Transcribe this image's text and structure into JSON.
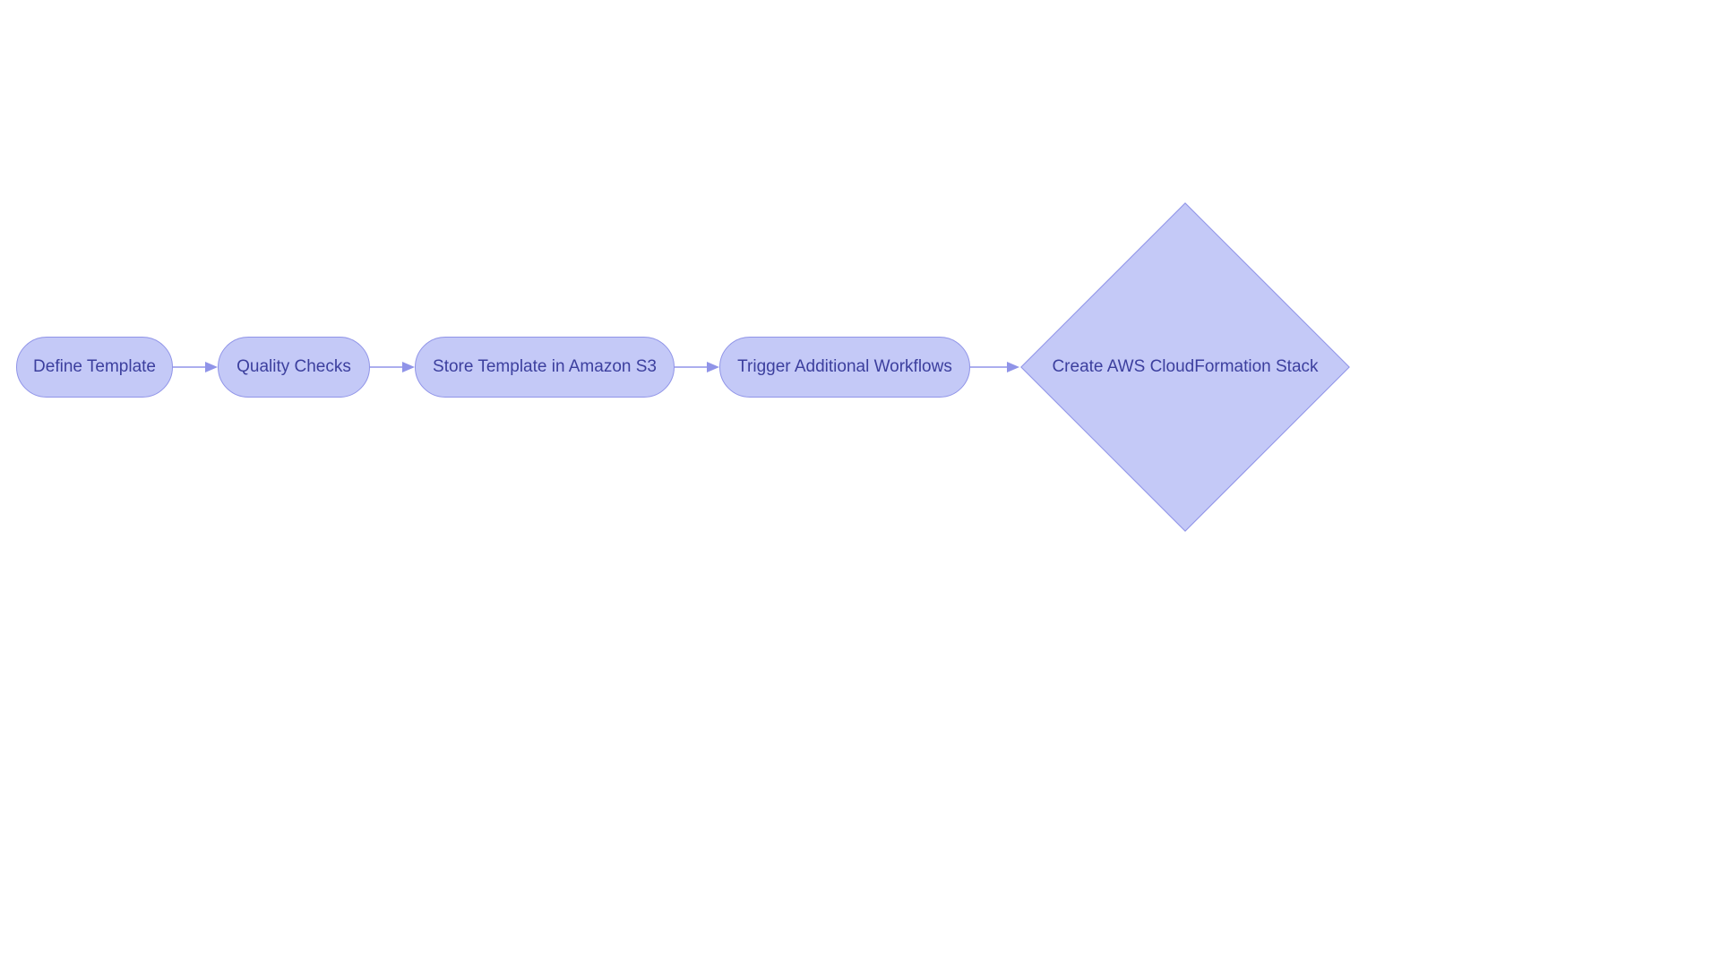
{
  "colors": {
    "node_fill": "#c4c9f7",
    "node_stroke": "#9094e8",
    "text": "#3c3f9e",
    "arrow": "#9094e8"
  },
  "nodes": {
    "n1": {
      "label": "Define Template",
      "shape": "pill"
    },
    "n2": {
      "label": "Quality Checks",
      "shape": "pill"
    },
    "n3": {
      "label": "Store Template in Amazon S3",
      "shape": "pill"
    },
    "n4": {
      "label": "Trigger Additional Workflows",
      "shape": "pill"
    },
    "n5": {
      "label": "Create AWS CloudFormation Stack",
      "shape": "diamond"
    }
  },
  "edges": [
    {
      "from": "n1",
      "to": "n2"
    },
    {
      "from": "n2",
      "to": "n3"
    },
    {
      "from": "n3",
      "to": "n4"
    },
    {
      "from": "n4",
      "to": "n5"
    }
  ]
}
